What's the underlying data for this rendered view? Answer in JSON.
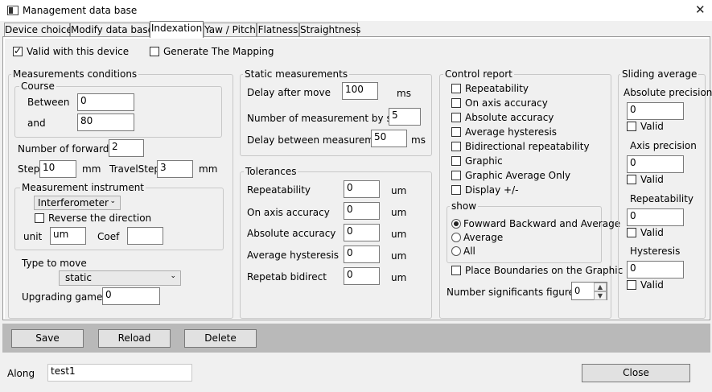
{
  "window": {
    "title": "Management data base"
  },
  "tabs": [
    "Device choice",
    "Modify data base",
    "Indexation",
    "Yaw / Pitch",
    "Flatness",
    "Straightness"
  ],
  "active_tab": "Indexation",
  "top_options": {
    "valid_device": {
      "label": "Valid with this device",
      "checked": true
    },
    "generate_mapping": {
      "label": "Generate The Mapping",
      "checked": false
    }
  },
  "measurement_conditions": {
    "legend": "Measurements conditions",
    "course": {
      "legend": "Course",
      "between_label": "Between",
      "between_value": "0",
      "and_label": "and",
      "and_value": "80"
    },
    "forward_label": "Number of forward",
    "forward_value": "2",
    "step_label": "Step",
    "step_value": "10",
    "step_unit": "mm",
    "travelstep_label": "TravelStep",
    "travelstep_value": "3",
    "travelstep_unit": "mm",
    "instrument": {
      "legend": "Measurement instrument",
      "selected": "Interferometer",
      "reverse_label": "Reverse the direction",
      "reverse_checked": false,
      "unit_label": "unit",
      "unit_value": "um",
      "coef_label": "Coef",
      "coef_value": ""
    },
    "type_label": "Type to move",
    "type_selected": "static",
    "upgrading_label": "Upgrading game",
    "upgrading_value": "0"
  },
  "static_measurements": {
    "legend": "Static measurements",
    "delay_label": "Delay after move",
    "delay_value": "100",
    "delay_unit": "ms",
    "nb_label": "Number of measurement by stop",
    "nb_value": "5",
    "between_label": "Delay between measurement",
    "between_value": "50",
    "between_unit": "ms"
  },
  "tolerances": {
    "legend": "Tolerances",
    "items": [
      {
        "label": "Repeatability",
        "value": "0",
        "unit": "um"
      },
      {
        "label": "On axis accuracy",
        "value": "0",
        "unit": "um"
      },
      {
        "label": "Absolute  accuracy",
        "value": "0",
        "unit": "um"
      },
      {
        "label": "Average hysteresis",
        "value": "0",
        "unit": "um"
      },
      {
        "label": "Repetab bidirect",
        "value": "0",
        "unit": "um"
      }
    ]
  },
  "control_report": {
    "legend": "Control report",
    "items": [
      {
        "label": "Repeatability",
        "checked": false
      },
      {
        "label": "On axis accuracy",
        "checked": false
      },
      {
        "label": "Absolute accuracy",
        "checked": false
      },
      {
        "label": "Average hysteresis",
        "checked": false
      },
      {
        "label": "Bidirectional repeatability",
        "checked": false
      },
      {
        "label": "Graphic",
        "checked": false
      },
      {
        "label": "Graphic Average Only",
        "checked": false
      },
      {
        "label": "Display +/-",
        "checked": false
      }
    ],
    "show": {
      "legend": "show",
      "options": [
        {
          "label": "Fowward Backward and Average",
          "selected": true
        },
        {
          "label": "Average",
          "selected": false
        },
        {
          "label": "All",
          "selected": false
        }
      ]
    },
    "boundaries_label": "Place Boundaries on the Graphic",
    "boundaries_checked": false,
    "sigfig_label": "Number significants figures",
    "sigfig_value": "0"
  },
  "sliding_average": {
    "legend": "Sliding average",
    "groups": [
      {
        "label": "Absolute precision",
        "value": "0",
        "valid_label": "Valid",
        "valid_checked": false
      },
      {
        "label": "Axis precision",
        "value": "0",
        "valid_label": "Valid",
        "valid_checked": false
      },
      {
        "label": "Repeatability",
        "value": "0",
        "valid_label": "Valid",
        "valid_checked": false
      },
      {
        "label": "Hysteresis",
        "value": "0",
        "valid_label": "Valid",
        "valid_checked": false
      }
    ]
  },
  "actions": {
    "save": "Save",
    "reload": "Reload",
    "delete": "Delete"
  },
  "footer": {
    "along_label": "Along",
    "along_value": "test1",
    "close": "Close"
  }
}
